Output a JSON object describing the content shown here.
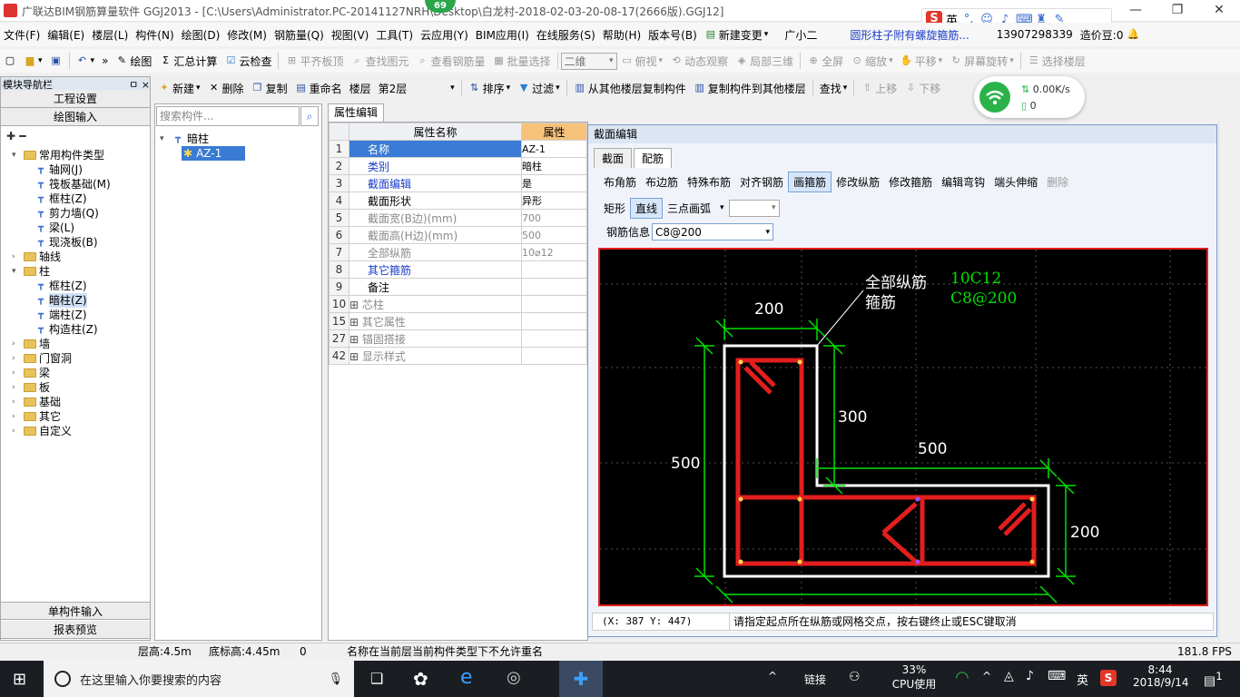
{
  "window": {
    "title": "广联达BIM钢筋算量软件 GGJ2013 - [C:\\Users\\Administrator.PC-20141127NRH\\Desktop\\白龙村-2018-02-03-20-08-17(2666版).GGJ12]",
    "badge": "69"
  },
  "ime": {
    "lang": "英",
    "punct": "°,"
  },
  "menu": {
    "items": [
      "文件(F)",
      "编辑(E)",
      "楼层(L)",
      "构件(N)",
      "绘图(D)",
      "修改(M)",
      "钢筋量(Q)",
      "视图(V)",
      "工具(T)",
      "云应用(Y)",
      "BIM应用(I)",
      "在线服务(S)",
      "帮助(H)",
      "版本号(B)"
    ],
    "new_change": "新建变更",
    "assistant": "广小二",
    "notice": "圆形柱子附有螺旋箍筋...",
    "phone": "13907298339",
    "beans": "造价豆:0"
  },
  "toolbar1": {
    "draw": "绘图",
    "sum": "汇总计算",
    "cloud_check": "云检查",
    "flat_top": "平齐板顶",
    "find": "查找图元",
    "view_rebar": "查看钢筋量",
    "batch_select": "批量选择",
    "view_mode": "二维",
    "top_view": "俯视",
    "dynamic": "动态观察",
    "local3d": "局部三维",
    "fullscreen": "全屏",
    "zoom": "缩放",
    "pan": "平移",
    "rotate": "屏幕旋转",
    "select_floor": "选择楼层"
  },
  "toolbar2": {
    "new": "新建",
    "delete": "删除",
    "copy": "复制",
    "rename": "重命名",
    "floor_label": "楼层",
    "floor_value": "第2层",
    "sort": "排序",
    "filter": "过滤",
    "copy_from": "从其他楼层复制构件",
    "copy_to": "复制构件到其他楼层",
    "find": "查找",
    "up": "上移",
    "down": "下移"
  },
  "network": {
    "speed": "0.00K/s",
    "count": "0"
  },
  "left_panel": {
    "title": "模块导航栏",
    "pin": "ㅁ ×",
    "project_settings": "工程设置",
    "drawing_input": "绘图输入",
    "single_input": "单构件输入",
    "report_preview": "报表预览",
    "tree": [
      {
        "label": "常用构件类型",
        "level": 0,
        "type": "folder",
        "expanded": true
      },
      {
        "label": "轴网(J)",
        "level": 1,
        "type": "item",
        "icon": "grid-icon"
      },
      {
        "label": "筏板基础(M)",
        "level": 1,
        "type": "item",
        "icon": "raft-icon"
      },
      {
        "label": "框柱(Z)",
        "level": 1,
        "type": "item",
        "icon": "column-icon"
      },
      {
        "label": "剪力墙(Q)",
        "level": 1,
        "type": "item",
        "icon": "wall-icon"
      },
      {
        "label": "梁(L)",
        "level": 1,
        "type": "item",
        "icon": "beam-icon"
      },
      {
        "label": "现浇板(B)",
        "level": 1,
        "type": "item",
        "icon": "slab-icon"
      },
      {
        "label": "轴线",
        "level": 0,
        "type": "folder",
        "expanded": false
      },
      {
        "label": "柱",
        "level": 0,
        "type": "folder",
        "expanded": true
      },
      {
        "label": "框柱(Z)",
        "level": 1,
        "type": "item",
        "icon": "column-icon"
      },
      {
        "label": "暗柱(Z)",
        "level": 1,
        "type": "item",
        "icon": "column-icon",
        "selected": true
      },
      {
        "label": "端柱(Z)",
        "level": 1,
        "type": "item",
        "icon": "column-icon"
      },
      {
        "label": "构造柱(Z)",
        "level": 1,
        "type": "item",
        "icon": "column-icon"
      },
      {
        "label": "墙",
        "level": 0,
        "type": "folder"
      },
      {
        "label": "门窗洞",
        "level": 0,
        "type": "folder"
      },
      {
        "label": "梁",
        "level": 0,
        "type": "folder"
      },
      {
        "label": "板",
        "level": 0,
        "type": "folder"
      },
      {
        "label": "基础",
        "level": 0,
        "type": "folder"
      },
      {
        "label": "其它",
        "level": 0,
        "type": "folder"
      },
      {
        "label": "自定义",
        "level": 0,
        "type": "folder"
      }
    ]
  },
  "component_panel": {
    "search_placeholder": "搜索构件...",
    "root": "暗柱",
    "child": "AZ-1"
  },
  "properties": {
    "tab": "属性编辑",
    "col_name": "属性名称",
    "col_value": "属性",
    "rows": [
      {
        "n": "1",
        "name": "名称",
        "value": "AZ-1",
        "style": "blue",
        "selected": true
      },
      {
        "n": "2",
        "name": "类别",
        "value": "暗柱",
        "style": "blue"
      },
      {
        "n": "3",
        "name": "截面编辑",
        "value": "是",
        "style": "blue"
      },
      {
        "n": "4",
        "name": "截面形状",
        "value": "异形",
        "style": "normal"
      },
      {
        "n": "5",
        "name": "截面宽(B边)(mm)",
        "value": "700",
        "style": "gray"
      },
      {
        "n": "6",
        "name": "截面高(H边)(mm)",
        "value": "500",
        "style": "gray"
      },
      {
        "n": "7",
        "name": "全部纵筋",
        "value": "10⌀12",
        "style": "gray"
      },
      {
        "n": "8",
        "name": "其它箍筋",
        "value": "",
        "style": "blue"
      },
      {
        "n": "9",
        "name": "备注",
        "value": "",
        "style": "normal"
      },
      {
        "n": "10",
        "name": "芯柱",
        "value": "",
        "style": "group"
      },
      {
        "n": "15",
        "name": "其它属性",
        "value": "",
        "style": "group"
      },
      {
        "n": "27",
        "name": "锚固搭接",
        "value": "",
        "style": "group"
      },
      {
        "n": "42",
        "name": "显示样式",
        "value": "",
        "style": "group"
      }
    ]
  },
  "section_dialog": {
    "title": "截面编辑",
    "tabs": [
      "截面",
      "配筋"
    ],
    "tools": [
      "布角筋",
      "布边筋",
      "特殊布筋",
      "对齐钢筋",
      "画箍筋",
      "修改纵筋",
      "修改箍筋",
      "编辑弯钩",
      "端头伸缩",
      "删除"
    ],
    "shape_tools": [
      "矩形",
      "直线",
      "三点画弧"
    ],
    "rebar_label": "钢筋信息",
    "rebar_value": "C8@200",
    "canvas": {
      "label_long": "全部纵筋",
      "value_long": "10C12",
      "label_stirrup": "箍筋",
      "value_stirrup": "C8@200",
      "dims": {
        "top": "200",
        "right_upper": "300",
        "mid": "500",
        "right_lower": "200",
        "left": "500"
      }
    },
    "coords": "(X: 387 Y: 447)",
    "hint": "请指定起点所在纵筋或网格交点，按右键终止或ESC键取消"
  },
  "statusbar": {
    "floor_height": "层高:4.5m",
    "base_elev": "底标高:4.45m",
    "zero": "0",
    "message": "名称在当前层当前构件类型下不允许重名",
    "fps": "181.8 FPS"
  },
  "taskbar": {
    "search": "在这里输入你要搜索的内容",
    "link": "链接",
    "cpu_pct": "33%",
    "cpu_label": "CPU使用",
    "lang": "英",
    "time": "8:44",
    "date": "2018/9/14",
    "notif": "1"
  },
  "colors": {
    "accent": "#3a7bd5",
    "canvas_bg": "#000000",
    "rebar": "#e21e1e",
    "dim": "#00e000"
  }
}
